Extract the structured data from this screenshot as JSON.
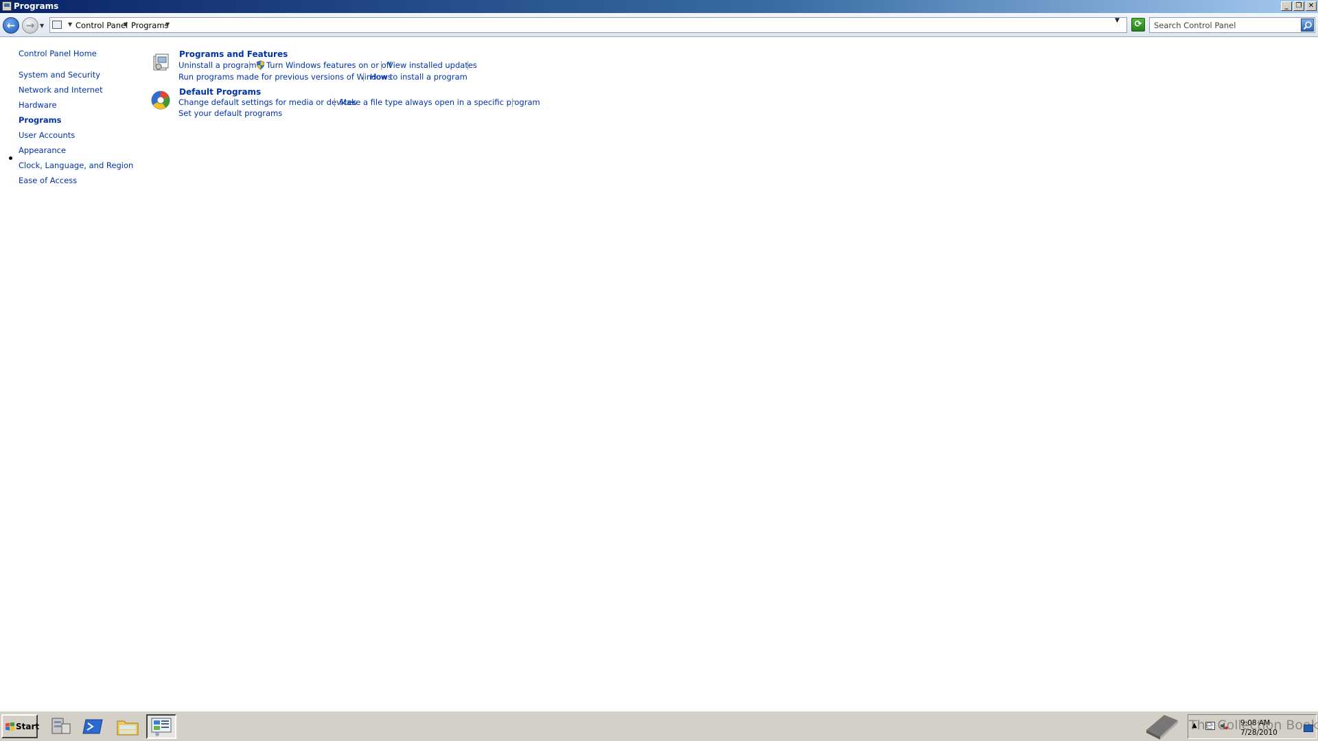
{
  "window": {
    "title": "Programs"
  },
  "address_bar": {
    "breadcrumbs": [
      "Control Panel",
      "Programs"
    ],
    "search_placeholder": "Search Control Panel"
  },
  "left_nav": {
    "items": [
      {
        "label": "Control Panel Home"
      },
      {
        "label": "System and Security"
      },
      {
        "label": "Network and Internet"
      },
      {
        "label": "Hardware"
      },
      {
        "label": "Programs",
        "current": true
      },
      {
        "label": "User Accounts"
      },
      {
        "label": "Appearance"
      },
      {
        "label": "Clock, Language, and Region"
      },
      {
        "label": "Ease of Access"
      }
    ]
  },
  "categories": [
    {
      "title": "Programs and Features",
      "icon": "programs-and-features-icon",
      "links": [
        "Uninstall a program",
        "Turn Windows features on or off",
        "View installed updates",
        "Run programs made for previous versions of Windows",
        "How to install a program"
      ]
    },
    {
      "title": "Default Programs",
      "icon": "default-programs-icon",
      "links": [
        "Change default settings for media or devices",
        "Make a file type always open in a specific program",
        "Set your default programs"
      ]
    }
  ],
  "taskbar": {
    "start_label": "Start",
    "pinned": [
      "server-manager-icon",
      "powershell-icon",
      "explorer-icon",
      "control-panel-icon"
    ],
    "clock_time": "9:08 AM",
    "clock_date": "7/28/2010"
  },
  "watermark": {
    "text": "The Collection Book"
  },
  "colors": {
    "link": "#0033a8",
    "titlebar_start": "#0a246a",
    "titlebar_end": "#a6caf0",
    "taskbar": "#d4d0c8"
  }
}
